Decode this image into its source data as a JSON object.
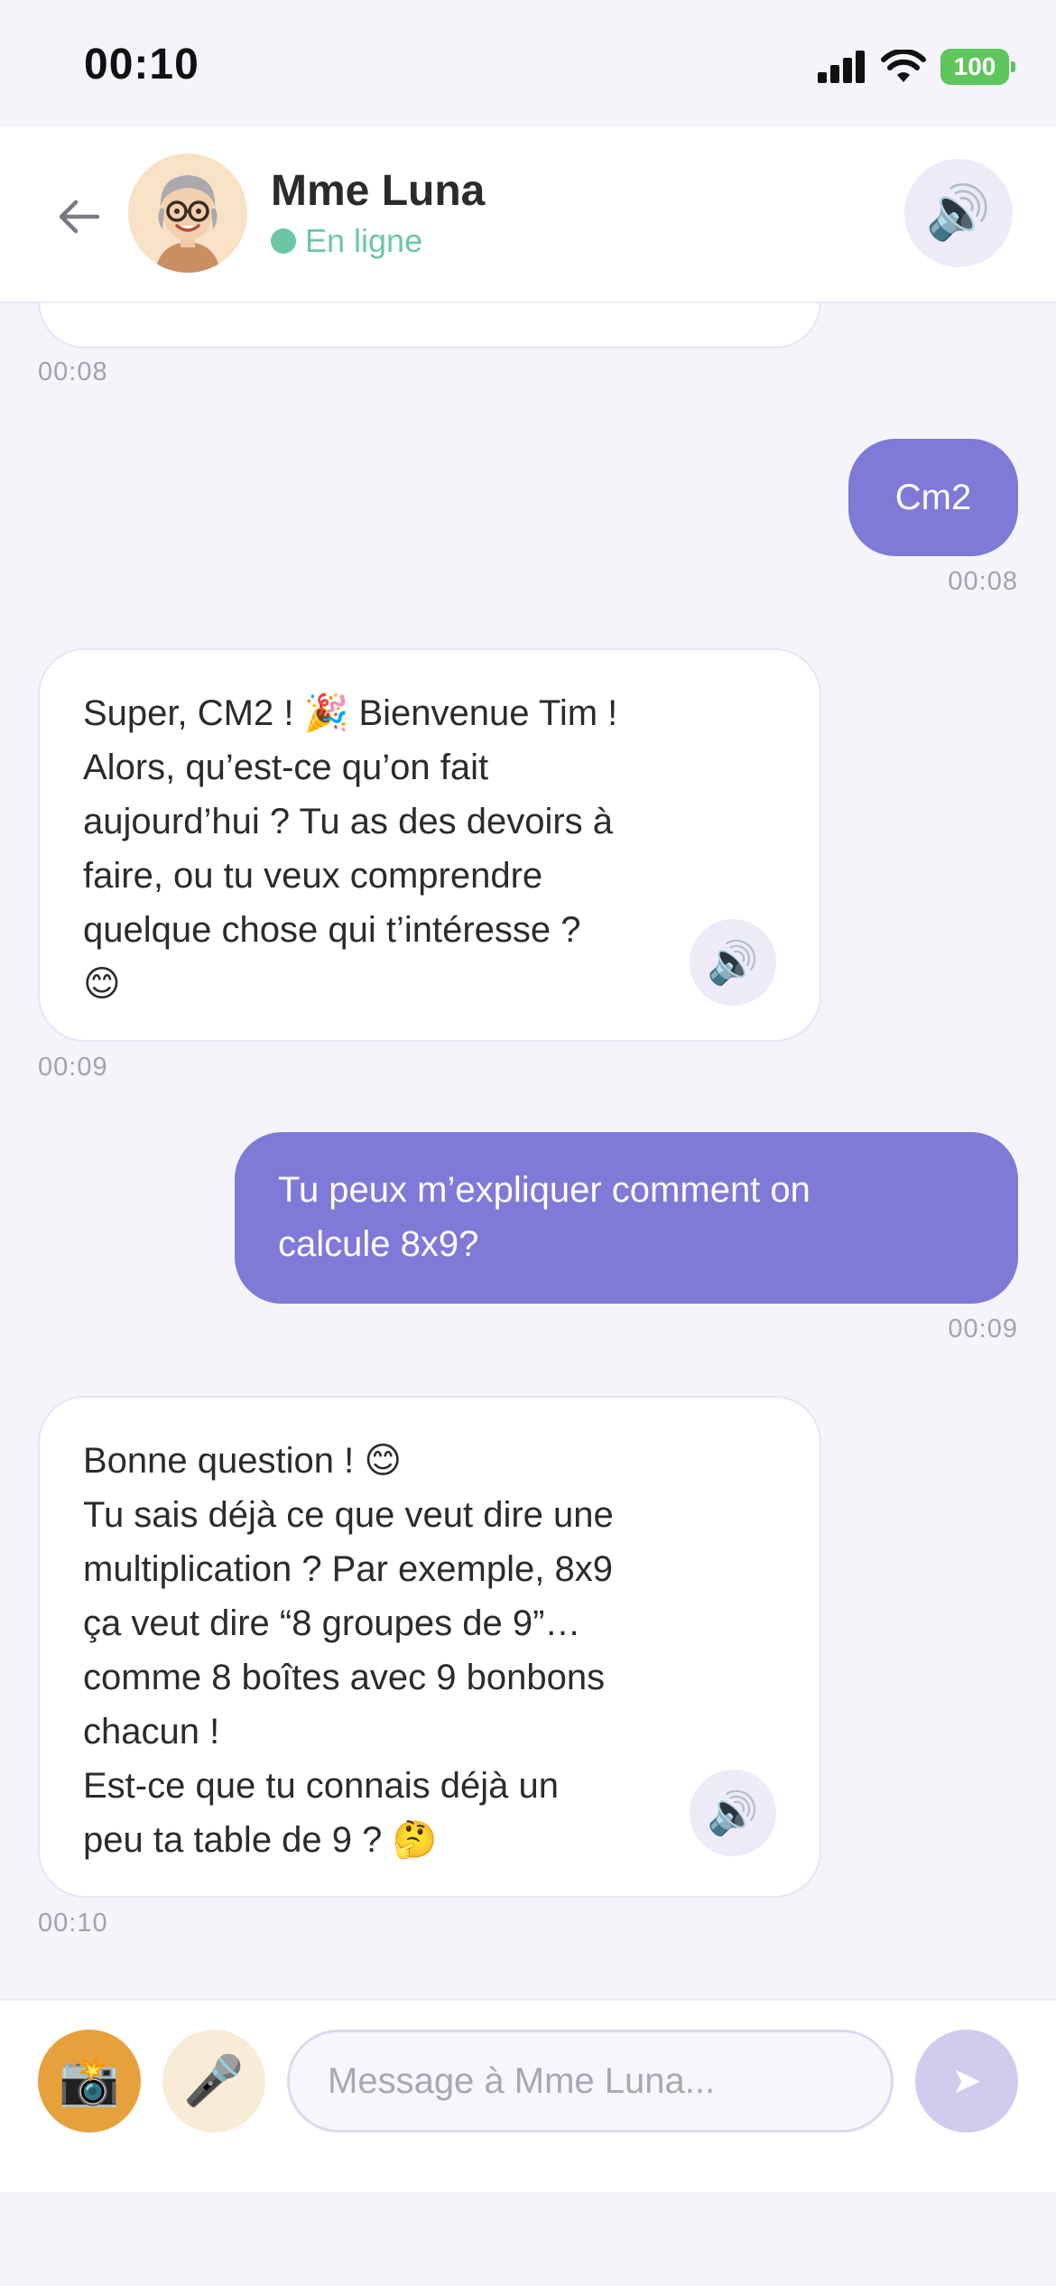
{
  "status_bar": {
    "time": "00:10",
    "battery": "100"
  },
  "header": {
    "contact_name": "Mme Luna",
    "status": "En ligne",
    "speaker_icon": "🔊"
  },
  "messages": [
    {
      "from": "bot",
      "text": "",
      "time": "00:08",
      "partial": true
    },
    {
      "from": "user",
      "text": "Cm2",
      "time": "00:08"
    },
    {
      "from": "bot",
      "text": "Super, CM2 ! 🎉 Bienvenue Tim !\nAlors, qu’est-ce qu’on fait\naujourd’hui ? Tu as des devoirs à\nfaire, ou tu veux comprendre\nquelque chose qui t’intéresse ?\n😊",
      "time": "00:09"
    },
    {
      "from": "user",
      "text": "Tu peux m’expliquer comment on\ncalcule 8x9?",
      "time": "00:09"
    },
    {
      "from": "bot",
      "text": "Bonne question ! 😊\nTu sais déjà ce que veut dire une\nmultiplication ? Par exemple, 8x9\nça veut dire “8 groupes de 9”…\ncomme 8 boîtes avec 9 bonbons\nchacun !\nEst-ce que tu connais déjà un\npeu ta table de 9 ? 🤔",
      "time": "00:10"
    }
  ],
  "input": {
    "placeholder": "Message à Mme Luna...",
    "camera_icon": "📸",
    "mic_icon": "🎤",
    "send_icon": "➤"
  }
}
